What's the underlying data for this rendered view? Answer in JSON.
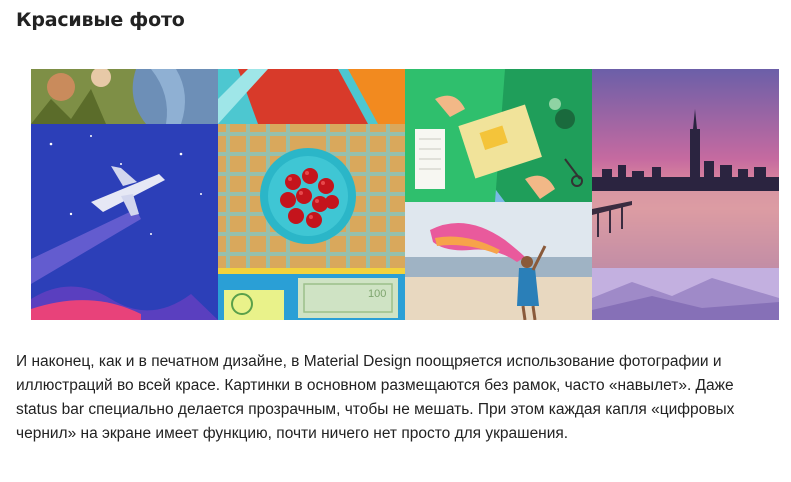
{
  "article": {
    "heading": "Красивые фото",
    "paragraph": "И наконец, как и в печатном дизайне, в Material Design поощряется использование фотографии и иллюстраций во всей красе. Картинки в основном размещаются без рамок, часто «навылет». Даже status bar специально делается прозрачным, чтобы не мешать. При этом каждая капля «цифровых чернил» на экране имеет функцию, почти ничего нет просто для украшения."
  },
  "gallery": {
    "money_label": "100"
  }
}
